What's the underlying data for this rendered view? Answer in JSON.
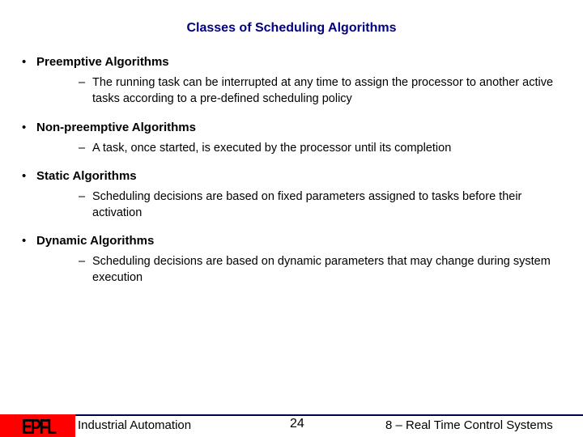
{
  "title": "Classes of Scheduling Algorithms",
  "sections": [
    {
      "heading": "Preemptive Algorithms",
      "details": [
        "The running task can be interrupted at any time to assign the processor to another active tasks according to a pre-defined scheduling policy"
      ]
    },
    {
      "heading": "Non-preemptive Algorithms",
      "details": [
        "A task, once started, is executed by the processor until its completion"
      ]
    },
    {
      "heading": "Static Algorithms",
      "details": [
        "Scheduling decisions are based on fixed parameters assigned to tasks before their activation"
      ]
    },
    {
      "heading": "Dynamic Algorithms",
      "details": [
        "Scheduling decisions are based on dynamic parameters that may change during system execution"
      ]
    }
  ],
  "bullet_glyph": "•",
  "dash_glyph": "–",
  "footer": {
    "logo_text": "EPFL",
    "course": "Industrial Automation",
    "page": "24",
    "chapter": "8 – Real Time Control Systems"
  }
}
